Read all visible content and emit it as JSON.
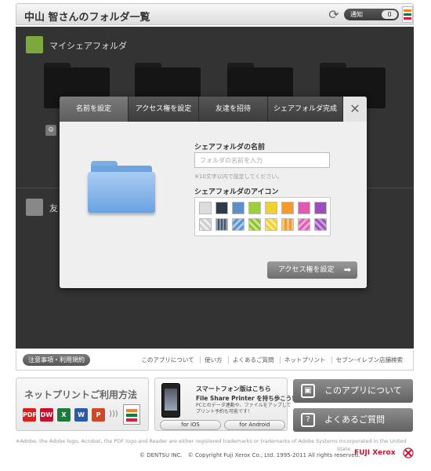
{
  "header": {
    "title": "中山 智さんのフォルダ一覧",
    "notice_label": "通知",
    "notice_count": "0"
  },
  "main": {
    "my_share_label": "マイシェアフォルダ",
    "friend_label": "友"
  },
  "modal": {
    "steps": [
      "名前を設定",
      "アクセス権を設定",
      "友達を招待",
      "シェアフォルダ完成"
    ],
    "active_step": 0,
    "name_label": "シェアフォルダの名前",
    "name_placeholder": "フォルダの名前を入力",
    "name_hint": "※10文字以内で設定してください。",
    "icon_label": "シェアフォルダのアイコン",
    "icon_colors": [
      "#d9dee3",
      "#2f3a4a",
      "#5d8fc7",
      "#9ccf3a",
      "#f0d130",
      "#f59a2c",
      "#e05ab0",
      "#9b4fb8"
    ],
    "next_button": "アクセス権を設定"
  },
  "footer": {
    "terms_button": "注意事項・利用規約",
    "links": [
      "このアプリについて",
      "使い方",
      "よくあるご質問",
      "ネットプリント",
      "セブン-イレブン店舗検索"
    ]
  },
  "bottom": {
    "netprint_title": "ネットプリントご利用方法",
    "app_icons": [
      {
        "label": "PDF",
        "color": "#d9221c"
      },
      {
        "label": "DW",
        "color": "#c8102e"
      },
      {
        "label": "X",
        "color": "#1d7a3a"
      },
      {
        "label": "W",
        "color": "#2a5aa8"
      },
      {
        "label": "P",
        "color": "#d24726"
      }
    ],
    "smartphone_title": "スマートフォン版はこちら",
    "smartphone_subtitle": "File Share Printer を持ち歩こう!",
    "smartphone_desc_1": "PCとのデータ連動や、ファイルをアップして",
    "smartphone_desc_2": "プリント予約も可能です！",
    "ios_button": "for iOS",
    "android_button": "for Android",
    "about_button": "このアプリについて",
    "faq_button": "よくあるご質問"
  },
  "legal": {
    "adobe": "※Adobe, the Adobe logo, Acrobat, the PDF logo and Reader are either registered trademarks or trademarks of Adobe Systems Incorporated in the United",
    "state": "State",
    "copyright": "© DENTSU INC.　© Copyright Fuji Xerox Co., Ltd. 1995-2011 All rights reserved.",
    "brand": "FUJI Xerox"
  },
  "colors": {
    "main_bg": "#333333",
    "modal_bg": "#efefef",
    "accent_red": "#d0112b",
    "folder_blue": "#6ba2e2"
  }
}
